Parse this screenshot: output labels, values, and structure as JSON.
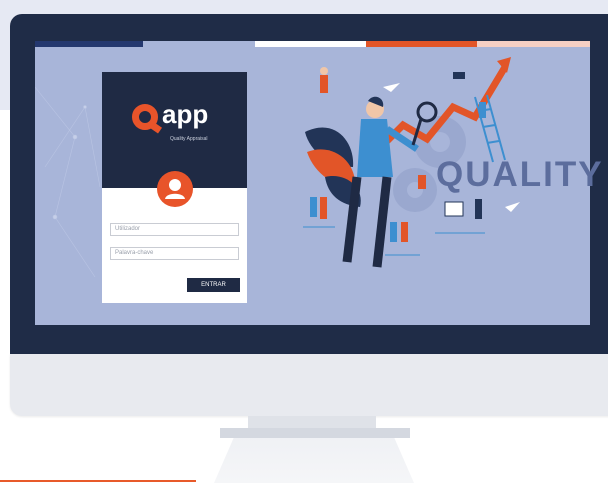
{
  "app": {
    "logo_text": "app",
    "logo_subtitle": "Quality Appraisal"
  },
  "login": {
    "username_placeholder": "Utilizador",
    "password_placeholder": "Palavra-chave",
    "submit_label": "ENTRAR"
  },
  "illustration": {
    "headline": "QUALITY"
  },
  "colors": {
    "accent": "#e8542a",
    "navy": "#1f2a44",
    "screen_bg": "#a8b5d9"
  }
}
